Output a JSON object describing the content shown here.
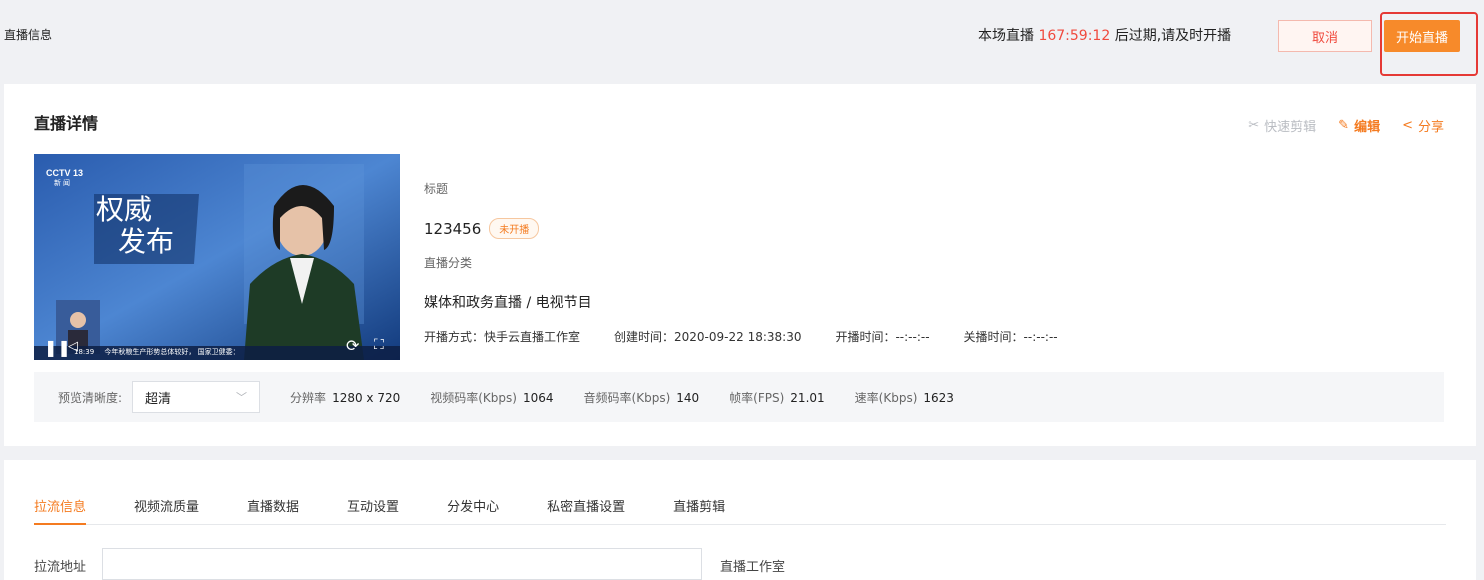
{
  "header": {
    "page_title": "直播信息",
    "countdown_prefix": "本场直播",
    "countdown_time": "167:59:12",
    "countdown_suffix": "后过期,请及时开播",
    "cancel_label": "取消",
    "start_label": "开始直播"
  },
  "detail": {
    "title": "直播详情",
    "actions": [
      {
        "icon": "scissors-icon",
        "label": "快速剪辑",
        "enabled": false
      },
      {
        "icon": "edit-icon",
        "label": "编辑",
        "enabled": true
      },
      {
        "icon": "share-icon",
        "label": "分享",
        "enabled": true
      }
    ],
    "video": {
      "channel_logo": "CCTV 13",
      "channel_sub": "新 闻",
      "caption_line1": "权威",
      "caption_line2": "发布",
      "ticker": "今年秋粮生产形势总体较好，  国家卫健委：",
      "ticker_time": "18:39"
    },
    "title_label": "标题",
    "title_value": "123456",
    "status_badge": "未开播",
    "category_label": "直播分类",
    "category_value": "媒体和政务直播 / 电视节目",
    "meta": {
      "mode": "开播方式：快手云直播工作室",
      "created": "创建时间：2020-09-22 18:38:30",
      "start": "开播时间：--:--:--",
      "end": "关播时间：--:--:--"
    }
  },
  "stats": {
    "preview_label": "预览清晰度:",
    "preview_value": "超清",
    "resolution_label": "分辨率",
    "resolution_value": "1280 x 720",
    "video_bitrate_label": "视频码率(Kbps)",
    "video_bitrate_value": "1064",
    "audio_bitrate_label": "音频码率(Kbps)",
    "audio_bitrate_value": "140",
    "fps_label": "帧率(FPS)",
    "fps_value": "21.01",
    "rate_label": "速率(Kbps)",
    "rate_value": "1623"
  },
  "tabs": [
    "拉流信息",
    "视频流质量",
    "直播数据",
    "互动设置",
    "分发中心",
    "私密直播设置",
    "直播剪辑"
  ],
  "pull": {
    "label": "拉流地址",
    "extra": "直播工作室"
  },
  "colors": {
    "accent": "#f47b20",
    "countdown": "#f04a3e",
    "highlight": "#e53935"
  }
}
